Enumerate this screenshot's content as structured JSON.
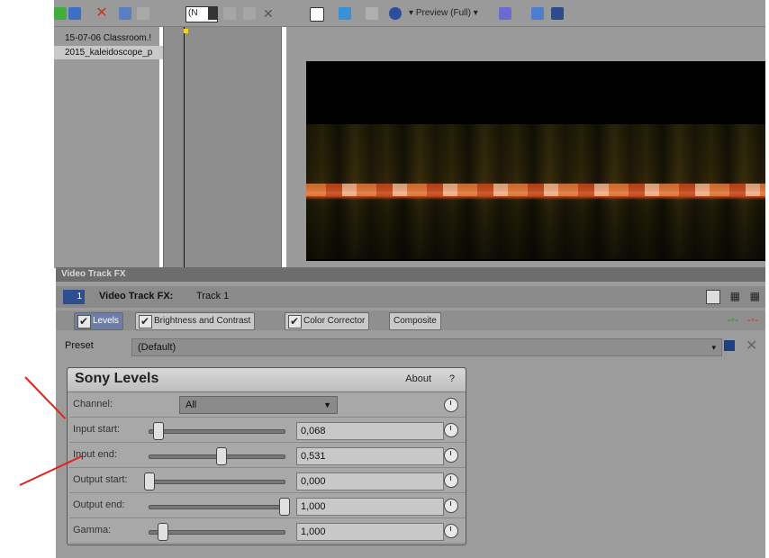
{
  "explorer": {
    "files": [
      "15-07-06 Classroom.!",
      "2015_kaleidoscope_p"
    ]
  },
  "trimmer": {
    "dropdown_value": "(N"
  },
  "preview_toolbar": {
    "label": "Preview (Full)"
  },
  "fx_window": {
    "title": "Video Track FX",
    "header_label": "Video Track FX:",
    "header_target": "Track 1",
    "chain": [
      "Levels",
      "Brightness and Contrast",
      "Color Corrector",
      "Composite"
    ],
    "preset_label": "Preset",
    "preset_value": "(Default)"
  },
  "plugin": {
    "title": "Sony Levels",
    "about": "About",
    "help": "?",
    "channel_label": "Channel:",
    "channel_value": "All",
    "params": [
      {
        "label": "Input start:",
        "value": "0,068",
        "level": 0.068
      },
      {
        "label": "Input end:",
        "value": "0,531",
        "level": 0.531
      },
      {
        "label": "Output start:",
        "value": "0,000",
        "level": 0.0
      },
      {
        "label": "Output end:",
        "value": "1,000",
        "level": 1.0
      },
      {
        "label": "Gamma:",
        "value": "1,000",
        "level": 0.1
      }
    ]
  },
  "colors": {
    "annotation_arrow": "#e0241b",
    "active_chip": "#6d7fa8"
  }
}
